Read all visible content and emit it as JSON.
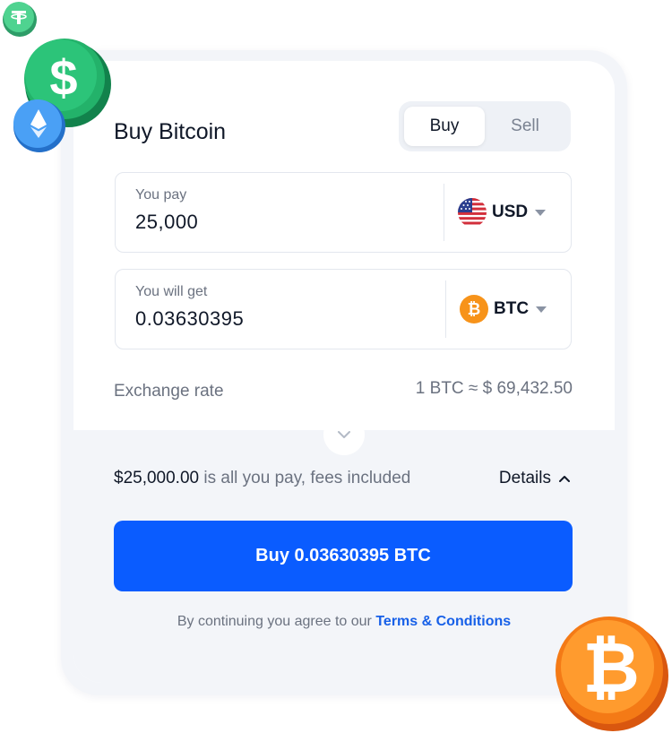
{
  "widget": {
    "title": "Buy Bitcoin",
    "tabs": [
      {
        "label": "Buy",
        "selected": true
      },
      {
        "label": "Sell",
        "selected": false
      }
    ]
  },
  "pay_field": {
    "label": "You pay",
    "value": "25,000",
    "currency": "USD",
    "currency_icon": "us-flag-icon"
  },
  "get_field": {
    "label": "You will get",
    "value": "0.03630395",
    "currency": "BTC",
    "currency_icon": "bitcoin-icon"
  },
  "exchange_rate": {
    "label": "Exchange rate",
    "value": "1 BTC ≈ $ 69,432.50"
  },
  "summary": {
    "amount": "$25,000.00",
    "text": " is all you pay, fees included",
    "details_label": "Details"
  },
  "buy_button": {
    "label": "Buy 0.03630395 BTC"
  },
  "terms": {
    "prefix": "By continuing you agree to our ",
    "link": "Terms & Conditions"
  },
  "colors": {
    "accent": "#0a5cff",
    "link": "#1760e8",
    "bitcoin": "#f7931a",
    "tether": "#3cc082",
    "dollar_coin": "#1fa765",
    "ethereum": "#3a8ff0"
  },
  "decorative_coins": [
    "tether-coin-icon",
    "dollar-coin-icon",
    "ethereum-coin-icon",
    "bitcoin-coin-icon"
  ]
}
